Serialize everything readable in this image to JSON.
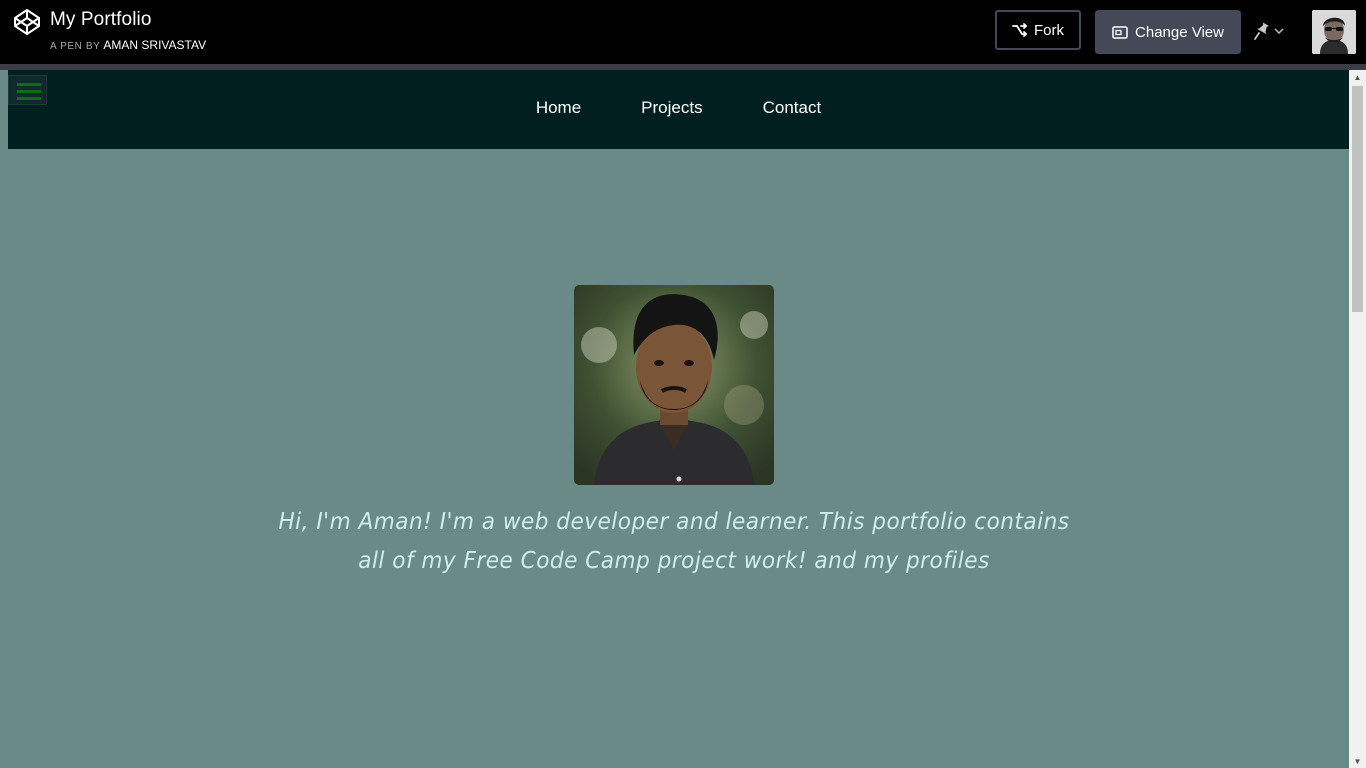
{
  "header": {
    "pen_title": "My Portfolio",
    "by_label": "A PEN BY",
    "author": "AMAN SRIVASTAV",
    "fork_label": "Fork",
    "change_view_label": "Change View"
  },
  "icons": {
    "logo": "codepen-logo-icon",
    "fork": "fork-icon",
    "change_view": "window-icon",
    "pin": "pin-icon",
    "dropdown": "chevron-down-icon",
    "menu": "hamburger-menu-icon"
  },
  "site": {
    "nav": [
      "Home",
      "Projects",
      "Contact"
    ],
    "intro": "Hi, I'm Aman! I'm a web developer and learner. This portfolio contains all of my Free Code Camp project work! and my profiles"
  },
  "colors": {
    "topbar": "#000000",
    "button": "#444857",
    "nav_bg": "#011f1f",
    "page_bg": "#6a8a88",
    "intro_text": "#cdeeee",
    "hamburger": "#0b6e14"
  }
}
